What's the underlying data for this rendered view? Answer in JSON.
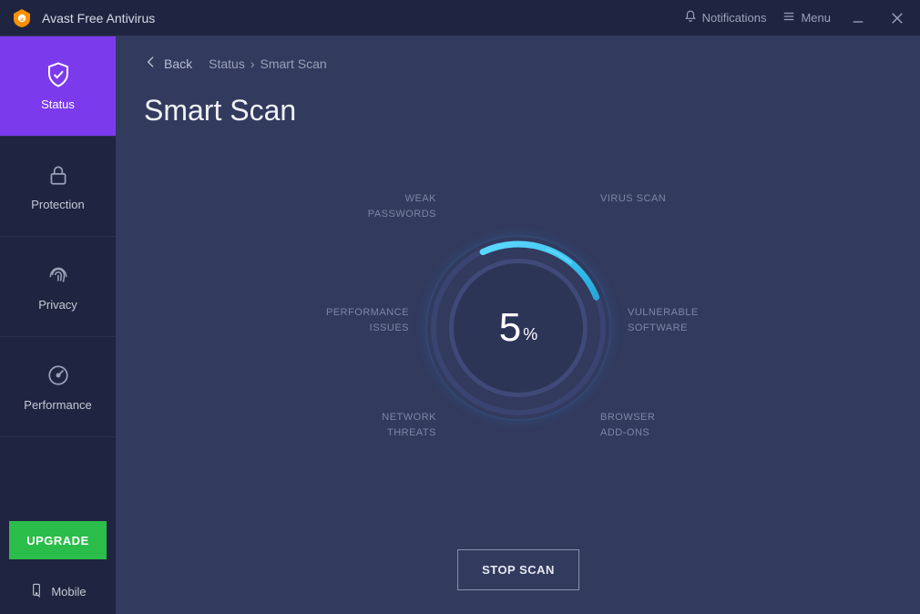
{
  "titlebar": {
    "app_title": "Avast Free Antivirus",
    "notifications_label": "Notifications",
    "menu_label": "Menu"
  },
  "sidebar": {
    "items": [
      {
        "label": "Status"
      },
      {
        "label": "Protection"
      },
      {
        "label": "Privacy"
      },
      {
        "label": "Performance"
      }
    ],
    "upgrade_label": "UPGRADE",
    "mobile_label": "Mobile"
  },
  "main": {
    "back_label": "Back",
    "breadcrumb_root": "Status",
    "breadcrumb_sep": "›",
    "breadcrumb_leaf": "Smart Scan",
    "page_title": "Smart Scan",
    "progress_percent": "5",
    "percent_symbol": "%",
    "categories": {
      "virus_scan": "VIRUS SCAN",
      "weak_passwords_1": "WEAK",
      "weak_passwords_2": "PASSWORDS",
      "performance_issues_1": "PERFORMANCE",
      "performance_issues_2": "ISSUES",
      "vulnerable_software_1": "VULNERABLE",
      "vulnerable_software_2": "SOFTWARE",
      "network_threats_1": "NETWORK",
      "network_threats_2": "THREATS",
      "browser_addons_1": "BROWSER",
      "browser_addons_2": "ADD-ONS"
    },
    "stop_button_label": "STOP SCAN"
  },
  "colors": {
    "accent": "#7c3aed",
    "upgrade": "#2bbd4a",
    "progress": "#2bb7e5"
  }
}
